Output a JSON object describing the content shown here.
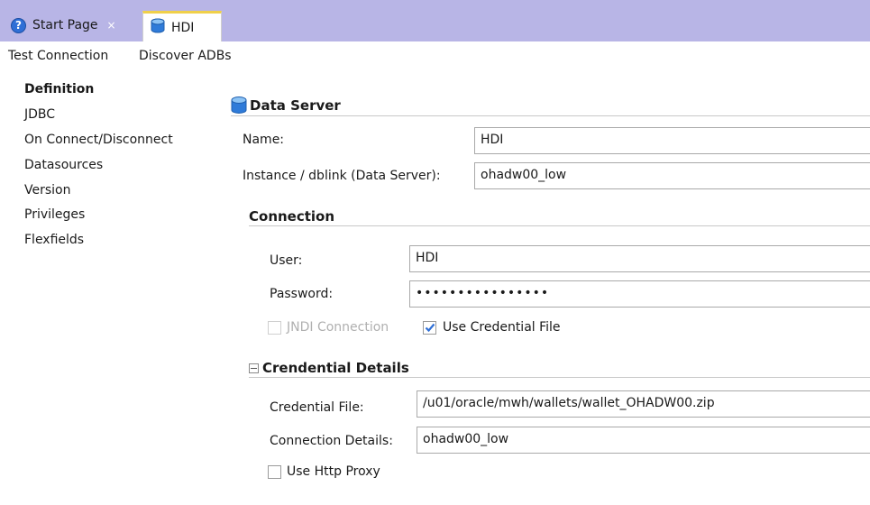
{
  "tabs": [
    {
      "label": "Start Page",
      "close": "×"
    },
    {
      "label": "HDI"
    }
  ],
  "toolbar": {
    "test_connection": "Test Connection",
    "discover_adbs": "Discover ADBs"
  },
  "nav": {
    "items": [
      {
        "label": "Definition"
      },
      {
        "label": "JDBC"
      },
      {
        "label": "On Connect/Disconnect"
      },
      {
        "label": "Datasources"
      },
      {
        "label": "Version"
      },
      {
        "label": "Privileges"
      },
      {
        "label": "Flexfields"
      }
    ]
  },
  "data_server": {
    "title": "Data Server",
    "name_label": "Name:",
    "name_value": "HDI",
    "instance_label": "Instance / dblink (Data Server):",
    "instance_value": "ohadw00_low"
  },
  "connection": {
    "title": "Connection",
    "user_label": "User:",
    "user_value": "HDI",
    "password_label": "Password:",
    "password_value": "••••••••••••••••",
    "jndi_label": "JNDI Connection",
    "jndi_checked": false,
    "use_credential_label": "Use Credential File",
    "use_credential_checked": true
  },
  "credential": {
    "title": "Crendential Details",
    "file_label": "Credential File:",
    "file_value": "/u01/oracle/mwh/wallets/wallet_OHADW00.zip",
    "details_label": "Connection Details:",
    "details_value": "ohadw00_low",
    "http_proxy_label": "Use Http Proxy",
    "http_proxy_checked": false
  },
  "colors": {
    "tabstrip": "#b8b5e6",
    "active_tab_accent": "#f0d04a",
    "check_blue": "#2f6fd6"
  }
}
